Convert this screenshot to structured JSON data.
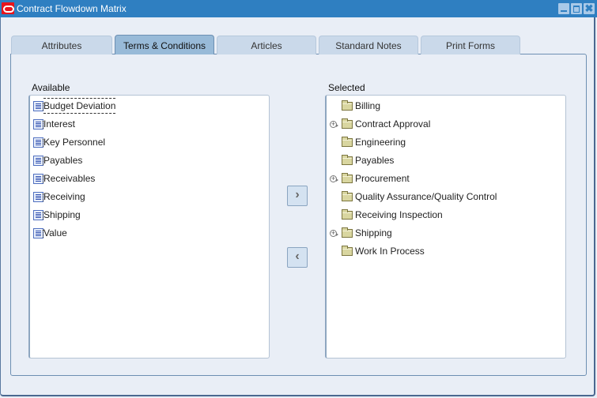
{
  "window": {
    "title": "Contract Flowdown Matrix",
    "controls": {
      "minimize": "minimize",
      "maximize": "maximize",
      "close": "✖"
    }
  },
  "tabs": [
    {
      "label": "Attributes",
      "active": false
    },
    {
      "label": "Terms & Conditions",
      "active": true
    },
    {
      "label": "Articles",
      "active": false
    },
    {
      "label": "Standard Notes",
      "active": false
    },
    {
      "label": "Print Forms",
      "active": false
    }
  ],
  "available": {
    "label": "Available",
    "items": [
      {
        "label": "Budget Deviation",
        "icon": "document-icon",
        "focused": true
      },
      {
        "label": "Interest",
        "icon": "document-icon"
      },
      {
        "label": "Key Personnel",
        "icon": "document-icon"
      },
      {
        "label": "Payables",
        "icon": "document-icon"
      },
      {
        "label": "Receivables",
        "icon": "document-icon"
      },
      {
        "label": "Receiving",
        "icon": "document-icon"
      },
      {
        "label": "Shipping",
        "icon": "document-icon"
      },
      {
        "label": "Value",
        "icon": "document-icon"
      }
    ]
  },
  "shuttle": {
    "move_right": "›",
    "move_left": "‹"
  },
  "selected": {
    "label": "Selected",
    "items": [
      {
        "label": "Billing",
        "expandable": false
      },
      {
        "label": "Contract Approval",
        "expandable": true
      },
      {
        "label": "Engineering",
        "expandable": false
      },
      {
        "label": "Payables",
        "expandable": false
      },
      {
        "label": "Procurement",
        "expandable": true
      },
      {
        "label": "Quality Assurance/Quality Control",
        "expandable": false
      },
      {
        "label": "Receiving Inspection",
        "expandable": false
      },
      {
        "label": "Shipping",
        "expandable": true
      },
      {
        "label": "Work In Process",
        "expandable": false
      }
    ]
  }
}
